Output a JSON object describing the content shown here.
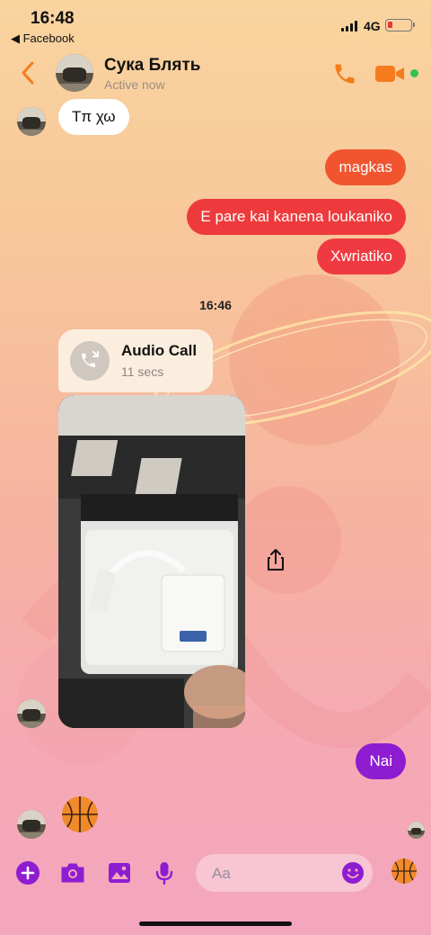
{
  "status_bar": {
    "time": "16:48",
    "back_app": "◀ Facebook",
    "network": "4G"
  },
  "header": {
    "contact_name": "Сука Блять",
    "status": "Active now",
    "icons": [
      "back-chevron-icon",
      "phone-icon",
      "video-camera-icon"
    ]
  },
  "colors": {
    "accent_orange": "#f47c1c",
    "accent_purple": "#8e1cd0",
    "outgoing_red": "#ee3a3c",
    "online_green": "#31c24d"
  },
  "messages": [
    {
      "direction": "incoming",
      "text": "Τπ χω"
    },
    {
      "direction": "outgoing",
      "text": "magkas"
    },
    {
      "direction": "outgoing",
      "text": "E pare kai kanena loukaniko"
    },
    {
      "direction": "outgoing",
      "text": "Xwriatiko"
    }
  ],
  "timestamp": "16:46",
  "call": {
    "title": "Audio Call",
    "duration": "11 secs",
    "icon": "missed-call-icon"
  },
  "reply": {
    "direction": "outgoing",
    "text": "Nai"
  },
  "composer": {
    "placeholder": "Aa",
    "tools": [
      "plus-icon",
      "camera-icon",
      "image-icon",
      "microphone-icon"
    ],
    "emoji_icon": "smiley-icon",
    "quick_reaction": "basketball-icon"
  }
}
